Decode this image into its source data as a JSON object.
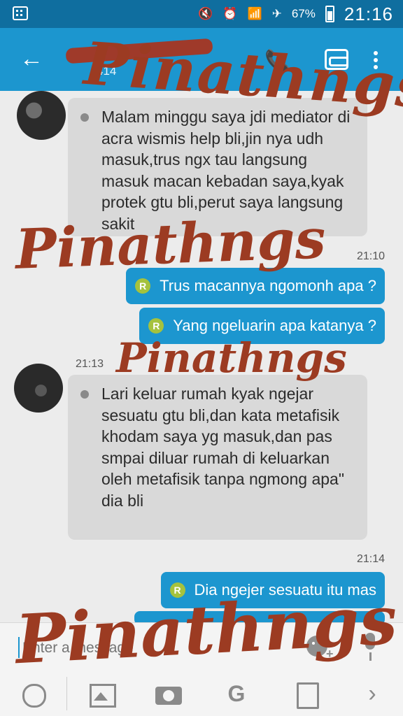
{
  "status_bar": {
    "battery": "67%",
    "time": "21:16",
    "icons": [
      "bbm-notification-icon",
      "mute-icon",
      "alarm-icon",
      "wifi-icon",
      "airplane-icon",
      "battery-icon"
    ]
  },
  "app_bar": {
    "contact_name": "",
    "contact_sub": "414",
    "icons": [
      "back-arrow-icon",
      "call-icon",
      "mask-icon",
      "overflow-menu-icon"
    ]
  },
  "messages": [
    {
      "direction": "in",
      "text": "Malam minggu saya jdi mediator di acra wismis help bli,jin nya udh masuk,trus ngx tau langsung masuk macan kebadan saya,kyak protek gtu bli,perut saya langsung sakit"
    },
    {
      "direction": "out",
      "time": "21:10",
      "text": "Trus macannya ngomonh apa ?",
      "status": "R"
    },
    {
      "direction": "out",
      "text": "Yang ngeluarin apa katanya ?",
      "status": "R"
    },
    {
      "direction": "in",
      "time": "21:13",
      "text": "Lari keluar rumah kyak ngejar sesuatu gtu bli,dan kata metafisik khodam saya yg masuk,dan pas smpai diluar rumah di keluarkan oleh metafisik tanpa ngmong apa\" dia bli"
    },
    {
      "direction": "out",
      "time": "21:14",
      "text": "Dia ngejer sesuatu itu mas",
      "status": "R"
    }
  ],
  "input": {
    "placeholder": "Enter a message"
  },
  "toolbar": {
    "icons": [
      "timer-icon",
      "image-icon",
      "camera-icon",
      "glympse-icon",
      "document-icon",
      "chevron-right-icon"
    ]
  },
  "watermark": "Pinathngs",
  "colors": {
    "status_bar": "#0f6e9f",
    "app_bar": "#1c96cf",
    "outgoing_bubble": "#1c96cf",
    "incoming_bubble": "#d9d9d9",
    "read_badge": "#a5c23d",
    "watermark": "#9c3b22"
  }
}
